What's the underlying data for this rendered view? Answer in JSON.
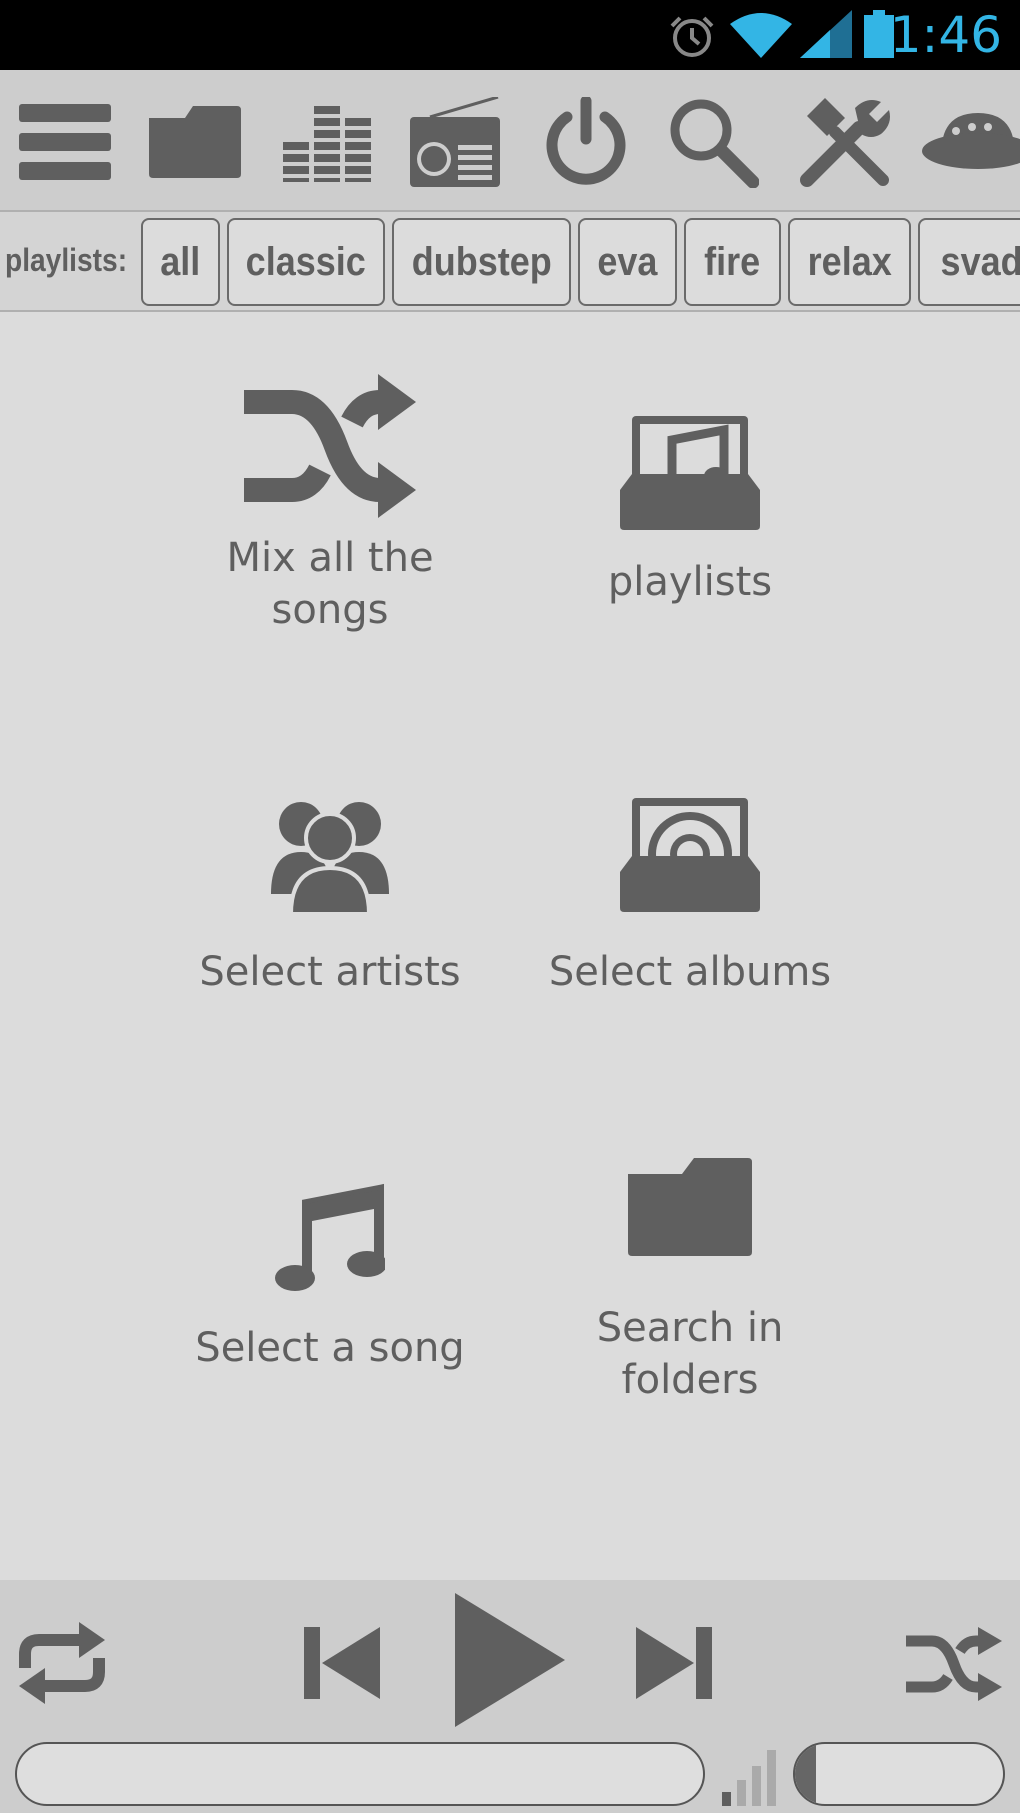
{
  "status_bar": {
    "time": "1:46",
    "icons": [
      "alarm-icon",
      "wifi-icon",
      "cell-signal-icon",
      "battery-icon"
    ],
    "accent_color": "#33b5e5"
  },
  "toolbar": {
    "icons": [
      "menu-icon",
      "folder-icon",
      "equalizer-icon",
      "radio-icon",
      "power-icon",
      "search-icon",
      "tools-icon",
      "ufo-icon"
    ]
  },
  "playlists_bar": {
    "label": "playlists:",
    "chips": [
      "all",
      "classic",
      "dubstep",
      "eva",
      "fire",
      "relax",
      "svad"
    ]
  },
  "grid": {
    "mix": "Mix all the\nsongs",
    "playlists": "playlists",
    "artists": "Select artists",
    "albums": "Select albums",
    "song": "Select a song",
    "folders": "Search in\nfolders"
  },
  "player": {
    "icons": [
      "repeat-icon",
      "previous-icon",
      "play-icon",
      "next-icon",
      "shuffle-icon",
      "volume-level-icon"
    ],
    "progress": 0,
    "volume": 0.1
  },
  "colors": {
    "icon": "#5f5f5f",
    "background": "#dcdcdc",
    "toolbar": "#cdcdcd"
  }
}
